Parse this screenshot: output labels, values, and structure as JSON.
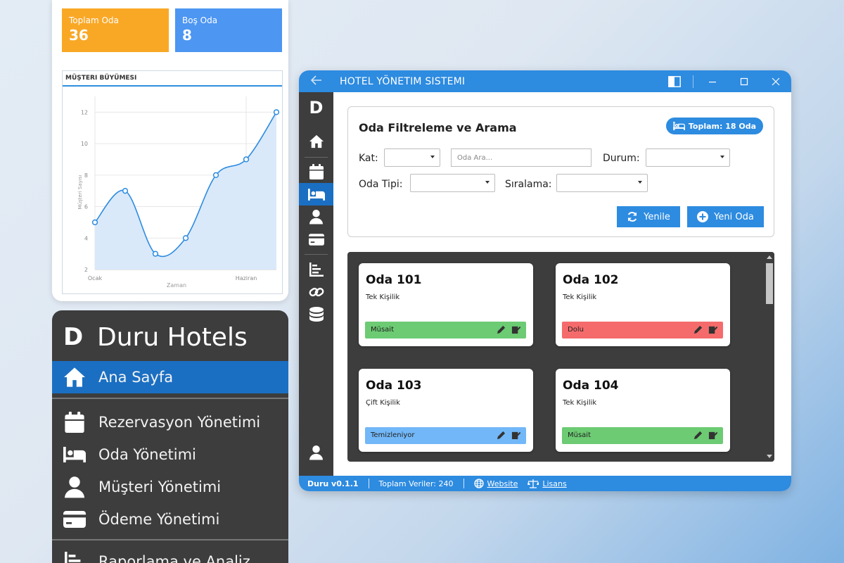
{
  "stats": {
    "total_rooms_label": "Toplam Oda",
    "total_rooms_value": "36",
    "empty_rooms_label": "Boş Oda",
    "empty_rooms_value": "8",
    "total_color": "#f9a826",
    "empty_color": "#4d96f2"
  },
  "growth_chart": {
    "title": "MÜŞTERI BÜYÜMESI",
    "ylabel": "Müşteri Sayısı",
    "xlabel": "Zaman",
    "x_ticks": [
      "Ocak",
      "Haziran"
    ],
    "y_ticks": [
      "2",
      "4",
      "6",
      "8",
      "10",
      "12"
    ]
  },
  "chart_data": {
    "type": "area",
    "title": "MÜŞTERI BÜYÜMESI",
    "xlabel": "Zaman",
    "ylabel": "Müşteri Sayısı",
    "x": [
      1,
      2,
      3,
      4,
      5,
      6,
      7
    ],
    "x_tick_labels": {
      "1": "Ocak",
      "6": "Haziran"
    },
    "values": [
      5,
      7,
      3,
      4,
      8,
      9,
      12
    ],
    "ylim": [
      2,
      13
    ],
    "y_ticks": [
      2,
      4,
      6,
      8,
      10,
      12
    ],
    "grid": true,
    "line_color": "#2d8be0",
    "fill_color": "#d9e9fa"
  },
  "brand": {
    "logo": "D",
    "name": "Duru Hotels"
  },
  "big_nav": [
    {
      "label": "Ana Sayfa",
      "icon": "home-icon"
    },
    {
      "label": "Rezervasyon Yönetimi",
      "icon": "calendar-icon"
    },
    {
      "label": "Oda Yönetimi",
      "icon": "bed-icon"
    },
    {
      "label": "Müşteri Yönetimi",
      "icon": "user-icon"
    },
    {
      "label": "Ödeme Yönetimi",
      "icon": "credit-card-icon"
    },
    {
      "label": "Raporlama ve Analiz",
      "icon": "chart-icon"
    }
  ],
  "window": {
    "title": "HOTEL YÖNETIM SISTEMI",
    "back_icon": "back-arrow-icon",
    "rail_logo": "D"
  },
  "filter": {
    "title": "Oda Filtreleme ve Arama",
    "total_badge": "Toplam: 18 Oda",
    "floor_label": "Kat:",
    "search_placeholder": "Oda Ara...",
    "status_label": "Durum:",
    "room_type_label": "Oda Tipi:",
    "sort_label": "Sıralama:",
    "refresh_label": "Yenile",
    "new_room_label": "Yeni Oda"
  },
  "rooms": [
    {
      "name": "Oda 101",
      "type": "Tek Kişilik",
      "status": "Müsait",
      "status_color": "#6ccb73"
    },
    {
      "name": "Oda 102",
      "type": "Tek Kişilik",
      "status": "Dolu",
      "status_color": "#f56b6b"
    },
    {
      "name": "Oda 103",
      "type": "Çift Kişilik",
      "status": "Temizleniyor",
      "status_color": "#72b8f8"
    },
    {
      "name": "Oda 104",
      "type": "Tek Kişilik",
      "status": "Müsait",
      "status_color": "#6ccb73"
    }
  ],
  "statusbar": {
    "version": "Duru v0.1.1",
    "total_data": "Toplam Veriler: 240",
    "website": "Website",
    "license": "Lisans"
  },
  "colors": {
    "accent": "#2d8be0",
    "active_nav": "#1a6fc2",
    "sidebar_bg": "#3d3d3d"
  }
}
